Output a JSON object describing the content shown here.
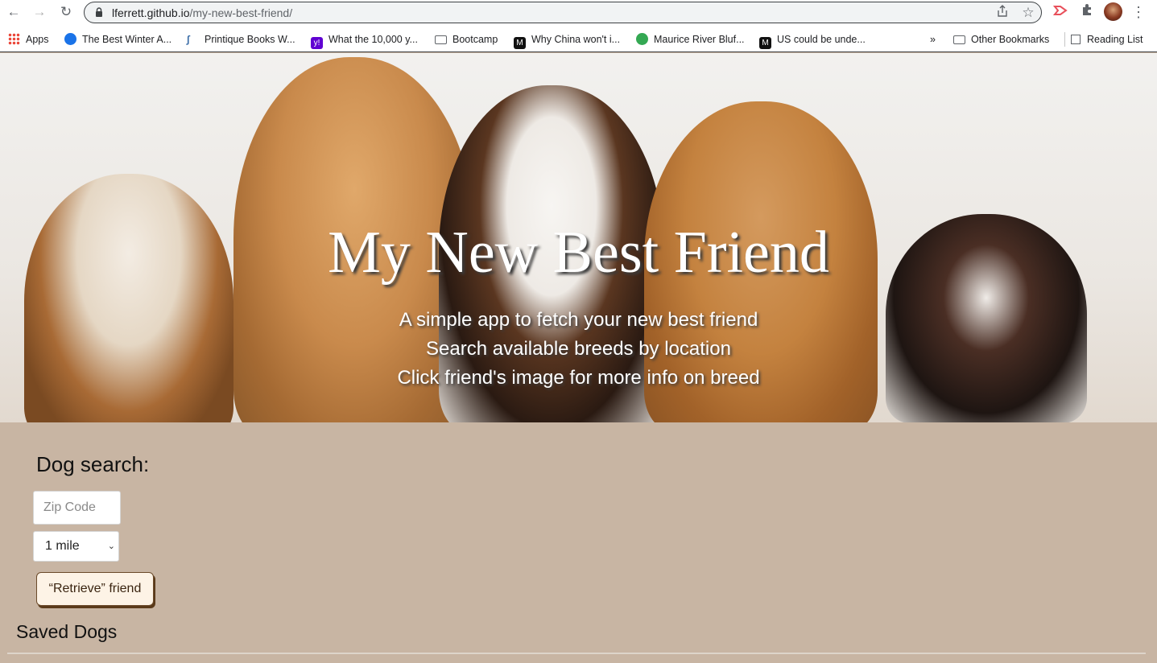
{
  "browser": {
    "url_host": "lferrett.github.io",
    "url_path": "/my-new-best-friend/",
    "bookmarks": [
      {
        "label": "Apps",
        "icon": "apps-grid-icon",
        "color": "#4285f4"
      },
      {
        "label": "The Best Winter A...",
        "icon": "globe-icon",
        "color": "#1a73e8"
      },
      {
        "label": "Printique Books W...",
        "icon": "printique-icon",
        "color": "#3c6ea8"
      },
      {
        "label": "What the 10,000 y...",
        "icon": "yahoo-icon",
        "color": "#6001d2"
      },
      {
        "label": "Bootcamp",
        "icon": "folder-icon",
        "color": "#5f6368"
      },
      {
        "label": "Why China won't i...",
        "icon": "medium-icon",
        "color": "#111111"
      },
      {
        "label": "Maurice River Bluf...",
        "icon": "earth-icon",
        "color": "#34a853"
      },
      {
        "label": "US could be unde...",
        "icon": "medium-icon",
        "color": "#111111"
      }
    ],
    "overflow": "»",
    "other_bookmarks": "Other Bookmarks",
    "reading_list": "Reading List"
  },
  "hero": {
    "title": "My New Best Friend",
    "lines": [
      "A simple app to fetch your new best friend",
      "Search available breeds by location",
      "Click friend's image for more info on breed"
    ]
  },
  "search": {
    "heading": "Dog search:",
    "zip_placeholder": "Zip Code",
    "zip_value": "",
    "distance_selected": "1 mile",
    "button_label": "“Retrieve” friend"
  },
  "saved": {
    "heading": "Saved Dogs"
  }
}
